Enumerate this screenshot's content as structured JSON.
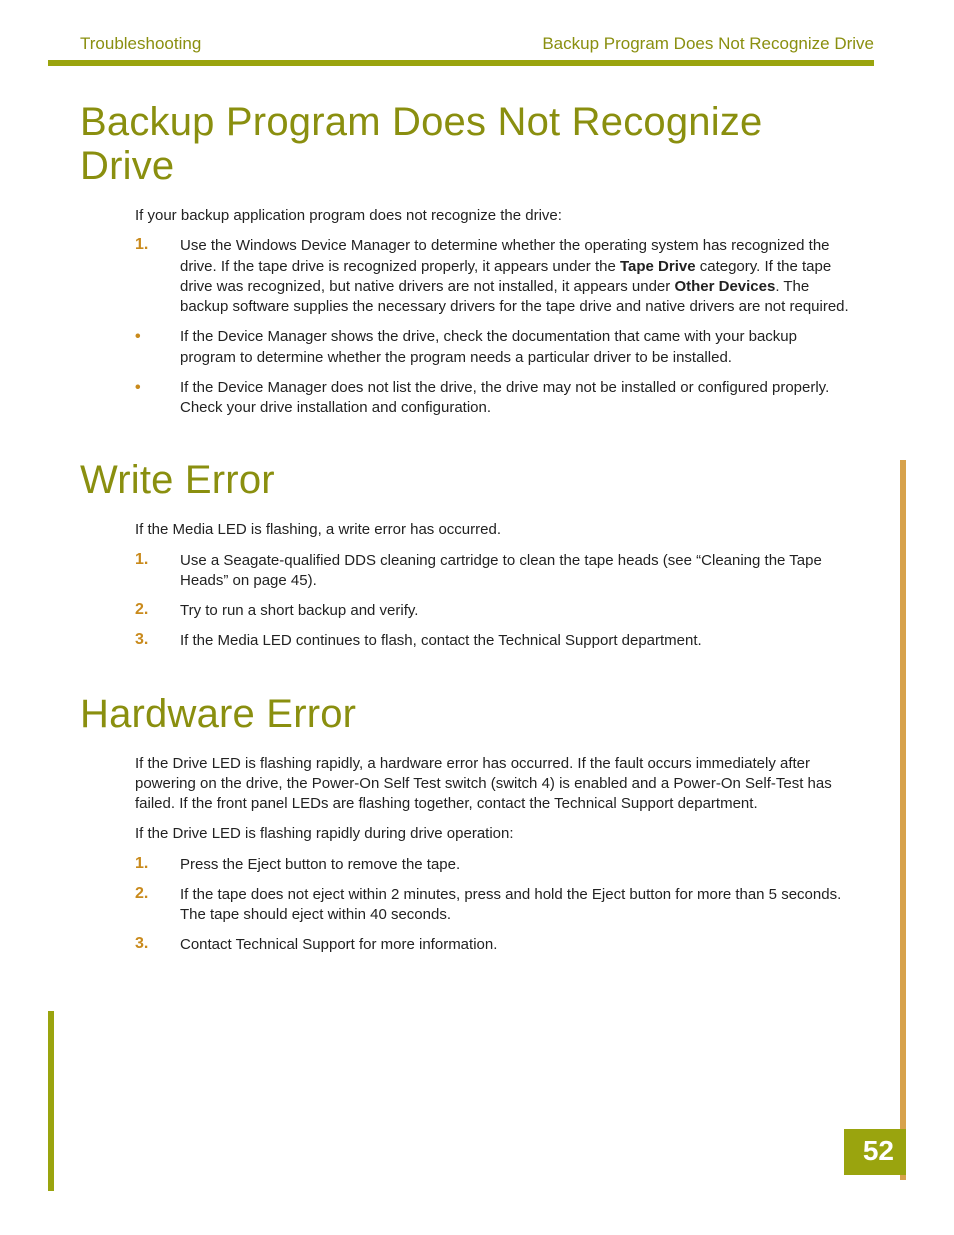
{
  "header": {
    "left": "Troubleshooting",
    "right": "Backup Program Does Not Recognize Drive"
  },
  "page_number": "52",
  "sections": [
    {
      "title": "Backup Program Does Not Recognize Drive",
      "intro": "If your backup application program does not recognize the drive:",
      "items": [
        {
          "type": "num",
          "marker": "1.",
          "html": "Use the Windows Device Manager to determine whether the operating system has recognized the drive. If the tape drive is recognized properly, it appears under the <b>Tape Drive</b> category. If the tape drive was recognized, but native drivers are not installed, it appears under <b>Other Devices</b>. The backup software supplies the necessary drivers for the tape drive and native drivers are not required."
        },
        {
          "type": "bullet",
          "marker": "•",
          "html": "If the Device Manager shows the drive, check the documentation that came with your backup program to determine whether the program needs a particular driver to be installed."
        },
        {
          "type": "bullet",
          "marker": "•",
          "html": "If the Device Manager does not list the drive, the drive may not be installed or configured properly. Check your drive installation and configuration."
        }
      ]
    },
    {
      "title": "Write Error",
      "intro": "If the Media LED is flashing, a write error has occurred.",
      "items": [
        {
          "type": "num",
          "marker": "1.",
          "html": "Use a Seagate-qualified DDS cleaning cartridge to clean the tape heads (see “Cleaning the Tape Heads” on page 45)."
        },
        {
          "type": "num",
          "marker": "2.",
          "html": "Try to run a short backup and verify."
        },
        {
          "type": "num",
          "marker": "3.",
          "html": "If the Media LED continues to flash, contact the Technical Support department."
        }
      ]
    },
    {
      "title": "Hardware Error",
      "intro": "If the Drive LED is flashing rapidly, a hardware error has occurred. If the fault occurs immediately after powering on the drive, the Power-On Self Test switch (switch 4) is enabled and a Power-On Self-Test has failed. If the front panel LEDs are flashing together, contact the Technical Support department.",
      "intro2": "If the Drive LED is flashing rapidly during drive operation:",
      "items": [
        {
          "type": "num",
          "marker": "1.",
          "html": "Press the Eject button to remove the tape."
        },
        {
          "type": "num",
          "marker": "2.",
          "html": "If the tape does not eject within 2 minutes, press and hold the Eject button for more than 5 seconds. The tape should eject within 40 seconds."
        },
        {
          "type": "num",
          "marker": "3.",
          "html": "Contact Technical Support for more information."
        }
      ]
    }
  ]
}
